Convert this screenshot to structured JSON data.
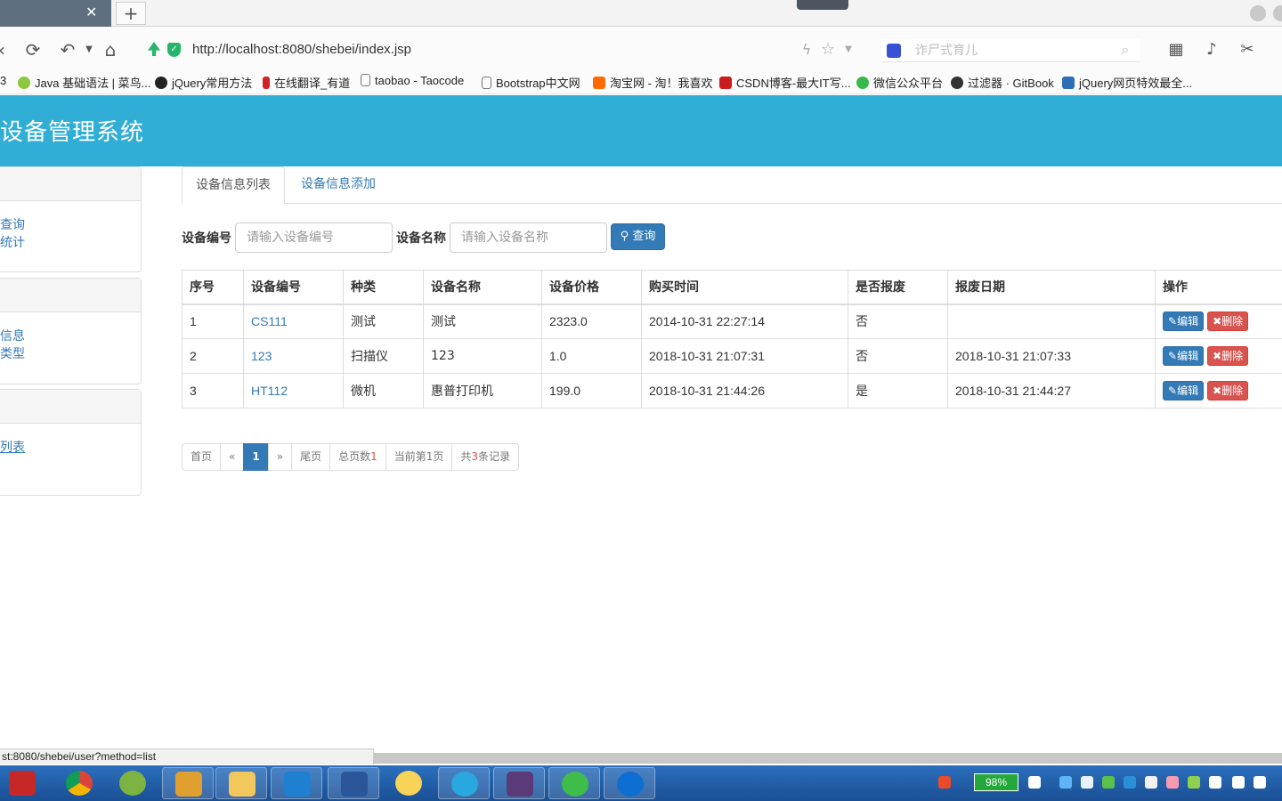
{
  "browser": {
    "url": "http://localhost:8080/shebei/index.jsp",
    "search_placeholder": "诈尸式育儿",
    "bookmarks": [
      {
        "label": "3",
        "color": "#ffffff"
      },
      {
        "label": "Java 基础语法 | 菜鸟...",
        "color": "#8dc63f"
      },
      {
        "label": "jQuery常用方法",
        "color": "#222222"
      },
      {
        "label": "在线翻译_有道",
        "color": "#d32222"
      },
      {
        "label": "taobao - Taocode",
        "color": "#ffffff"
      },
      {
        "label": "Bootstrap中文网",
        "color": "#ffffff"
      },
      {
        "label": "淘宝网 - 淘！我喜欢",
        "color": "#ff6a00"
      },
      {
        "label": "CSDN博客-最大IT写...",
        "color": "#c91d1d"
      },
      {
        "label": "微信公众平台",
        "color": "#36b94a"
      },
      {
        "label": "过滤器 · GitBook",
        "color": "#333333"
      },
      {
        "label": "jQuery网页特效最全...",
        "color": "#2c6fb7"
      }
    ],
    "status_text": "st:8080/shebei/user?method=list"
  },
  "app": {
    "title": "设备管理系统",
    "accent": "#31aed6"
  },
  "sidebar": {
    "panels": [
      {
        "links": [
          "查询",
          "统计"
        ]
      },
      {
        "links": [
          "信息",
          "类型"
        ]
      },
      {
        "links": [
          "列表",
          ""
        ]
      }
    ]
  },
  "tabs": [
    {
      "label": "设备信息列表",
      "active": true
    },
    {
      "label": "设备信息添加",
      "active": false
    }
  ],
  "search": {
    "code_label": "设备编号",
    "code_placeholder": "请输入设备编号",
    "name_label": "设备名称",
    "name_placeholder": "请输入设备名称",
    "button_label": "查询"
  },
  "table": {
    "headers": [
      "序号",
      "设备编号",
      "种类",
      "设备名称",
      "设备价格",
      "购买时间",
      "是否报废",
      "报废日期",
      "操作"
    ],
    "rows": [
      {
        "index": "1",
        "code": "CS111",
        "type": "测试",
        "name": "测试",
        "price": "2323.0",
        "buy_time": "2014-10-31 22:27:14",
        "scrapped": "否",
        "scrap_date": ""
      },
      {
        "index": "2",
        "code": "123",
        "type": "扫描仪",
        "name": "123",
        "price": "1.0",
        "buy_time": "2018-10-31 21:07:31",
        "scrapped": "否",
        "scrap_date": "2018-10-31 21:07:33"
      },
      {
        "index": "3",
        "code": "HT112",
        "type": "微机",
        "name": "惠普打印机",
        "price": "199.0",
        "buy_time": "2018-10-31 21:44:26",
        "scrapped": "是",
        "scrap_date": "2018-10-31 21:44:27"
      }
    ],
    "edit_label": "编辑",
    "delete_label": "删除"
  },
  "pagination": {
    "first": "首页",
    "prev": "«",
    "current": "1",
    "next": "»",
    "last": "尾页",
    "total_pages_prefix": "总页数",
    "total_pages": "1",
    "current_page_prefix": "当前第",
    "current_page": "1",
    "current_page_suffix": "页",
    "total_records_prefix": "共",
    "total_records": "3",
    "total_records_suffix": "条记录"
  },
  "taskbar": {
    "battery": "98%"
  }
}
